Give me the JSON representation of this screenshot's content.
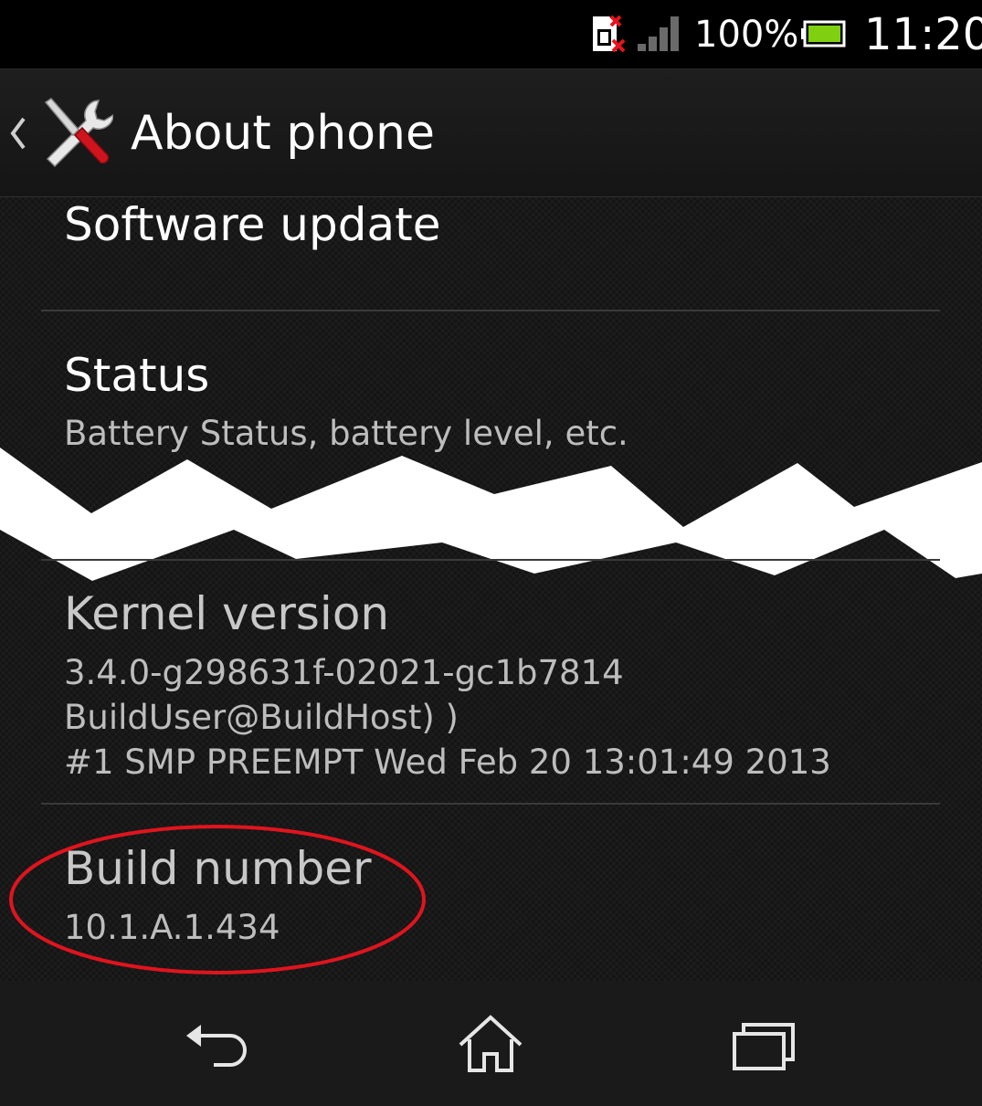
{
  "status_bar": {
    "battery_percent_text": "100%",
    "time": "11:20",
    "icons": [
      "sim-missing-icon",
      "no-signal-icon",
      "battery-full-icon"
    ],
    "battery_color": "#7fd010"
  },
  "action_bar": {
    "title": "About phone",
    "icon": "settings-tools-icon",
    "back_icon": "chevron-left-icon"
  },
  "preferences": [
    {
      "title": "Software update",
      "summary": ""
    },
    {
      "title": "Status",
      "summary": "Battery Status, battery level, etc."
    },
    {
      "title": "Kernel version",
      "summary_lines": [
        "3.4.0-g298631f-02021-gc1b7814",
        "BuildUser@BuildHost) )",
        "#1 SMP PREEMPT Wed Feb 20 13:01:49 2013"
      ]
    },
    {
      "title": "Build number",
      "summary": "10.1.A.1.434"
    }
  ],
  "annotation": {
    "shape": "ellipse",
    "color": "#e0141e",
    "target": "Build number"
  },
  "nav_bar": {
    "icons": [
      "back-icon",
      "home-icon",
      "recent-apps-icon"
    ]
  }
}
